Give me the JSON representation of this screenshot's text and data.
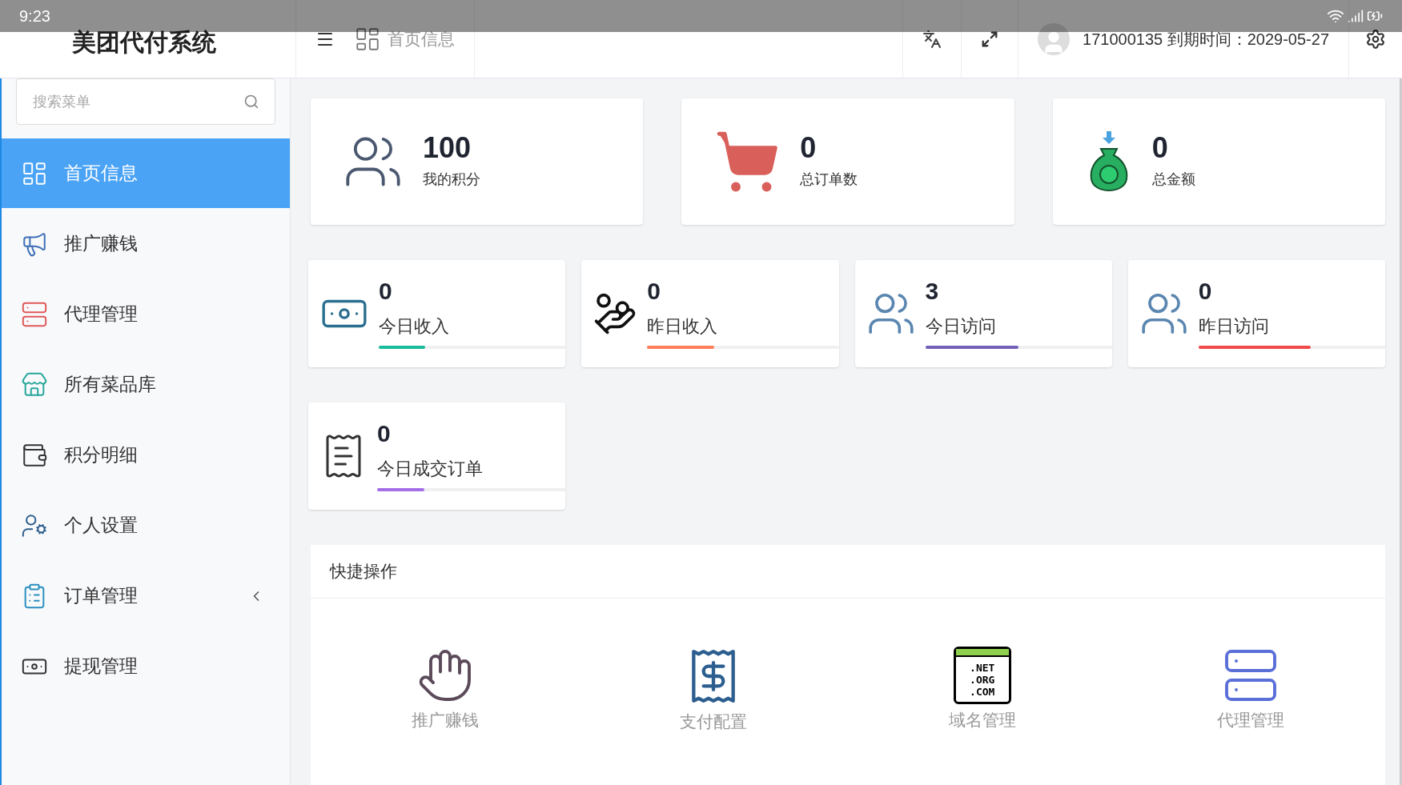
{
  "status_bar": {
    "time": "9:23"
  },
  "header": {
    "brand": "美团代付系统",
    "breadcrumb": "首页信息",
    "user": "171000135 到期时间：2029-05-27"
  },
  "sidebar": {
    "search": {
      "placeholder": "搜索菜单"
    },
    "items": [
      {
        "label": "首页信息",
        "selected": true,
        "expandable": false
      },
      {
        "label": "推广赚钱",
        "selected": false,
        "expandable": false
      },
      {
        "label": "代理管理",
        "selected": false,
        "expandable": false
      },
      {
        "label": "所有菜品库",
        "selected": false,
        "expandable": false
      },
      {
        "label": "积分明细",
        "selected": false,
        "expandable": false
      },
      {
        "label": "个人设置",
        "selected": false,
        "expandable": false
      },
      {
        "label": "订单管理",
        "selected": false,
        "expandable": true
      },
      {
        "label": "提现管理",
        "selected": false,
        "expandable": false
      }
    ]
  },
  "summary_cards": [
    {
      "kind": "team",
      "value": "100",
      "label": "我的积分"
    },
    {
      "kind": "cart",
      "value": "0",
      "label": "总订单数"
    },
    {
      "kind": "moneybag",
      "value": "0",
      "label": "总金额"
    }
  ],
  "metric_cards": [
    {
      "kind": "cash",
      "value": "0",
      "label": "今日收入",
      "level": 0.25,
      "color": "#1abc9c"
    },
    {
      "kind": "coins",
      "value": "0",
      "label": "昨日收入",
      "level": 0.35,
      "color": "#fd7e5b"
    },
    {
      "kind": "people",
      "value": "3",
      "label": "今日访问",
      "level": 0.5,
      "color": "#7460b8"
    },
    {
      "kind": "people",
      "value": "0",
      "label": "昨日访问",
      "level": 0.6,
      "color": "#f04a4a"
    },
    {
      "kind": "order",
      "value": "0",
      "label": "今日成交订单",
      "level": 0.25,
      "color": "#a36ee6"
    }
  ],
  "quick_actions": {
    "title": "快捷操作",
    "items": [
      {
        "kind": "promote",
        "label": "推广赚钱"
      },
      {
        "kind": "pay",
        "label": "支付配置"
      },
      {
        "kind": "domain",
        "label": "域名管理",
        "icon_lines": [
          ".NET",
          ".ORG",
          ".COM"
        ]
      },
      {
        "kind": "agent",
        "label": "代理管理"
      }
    ]
  }
}
